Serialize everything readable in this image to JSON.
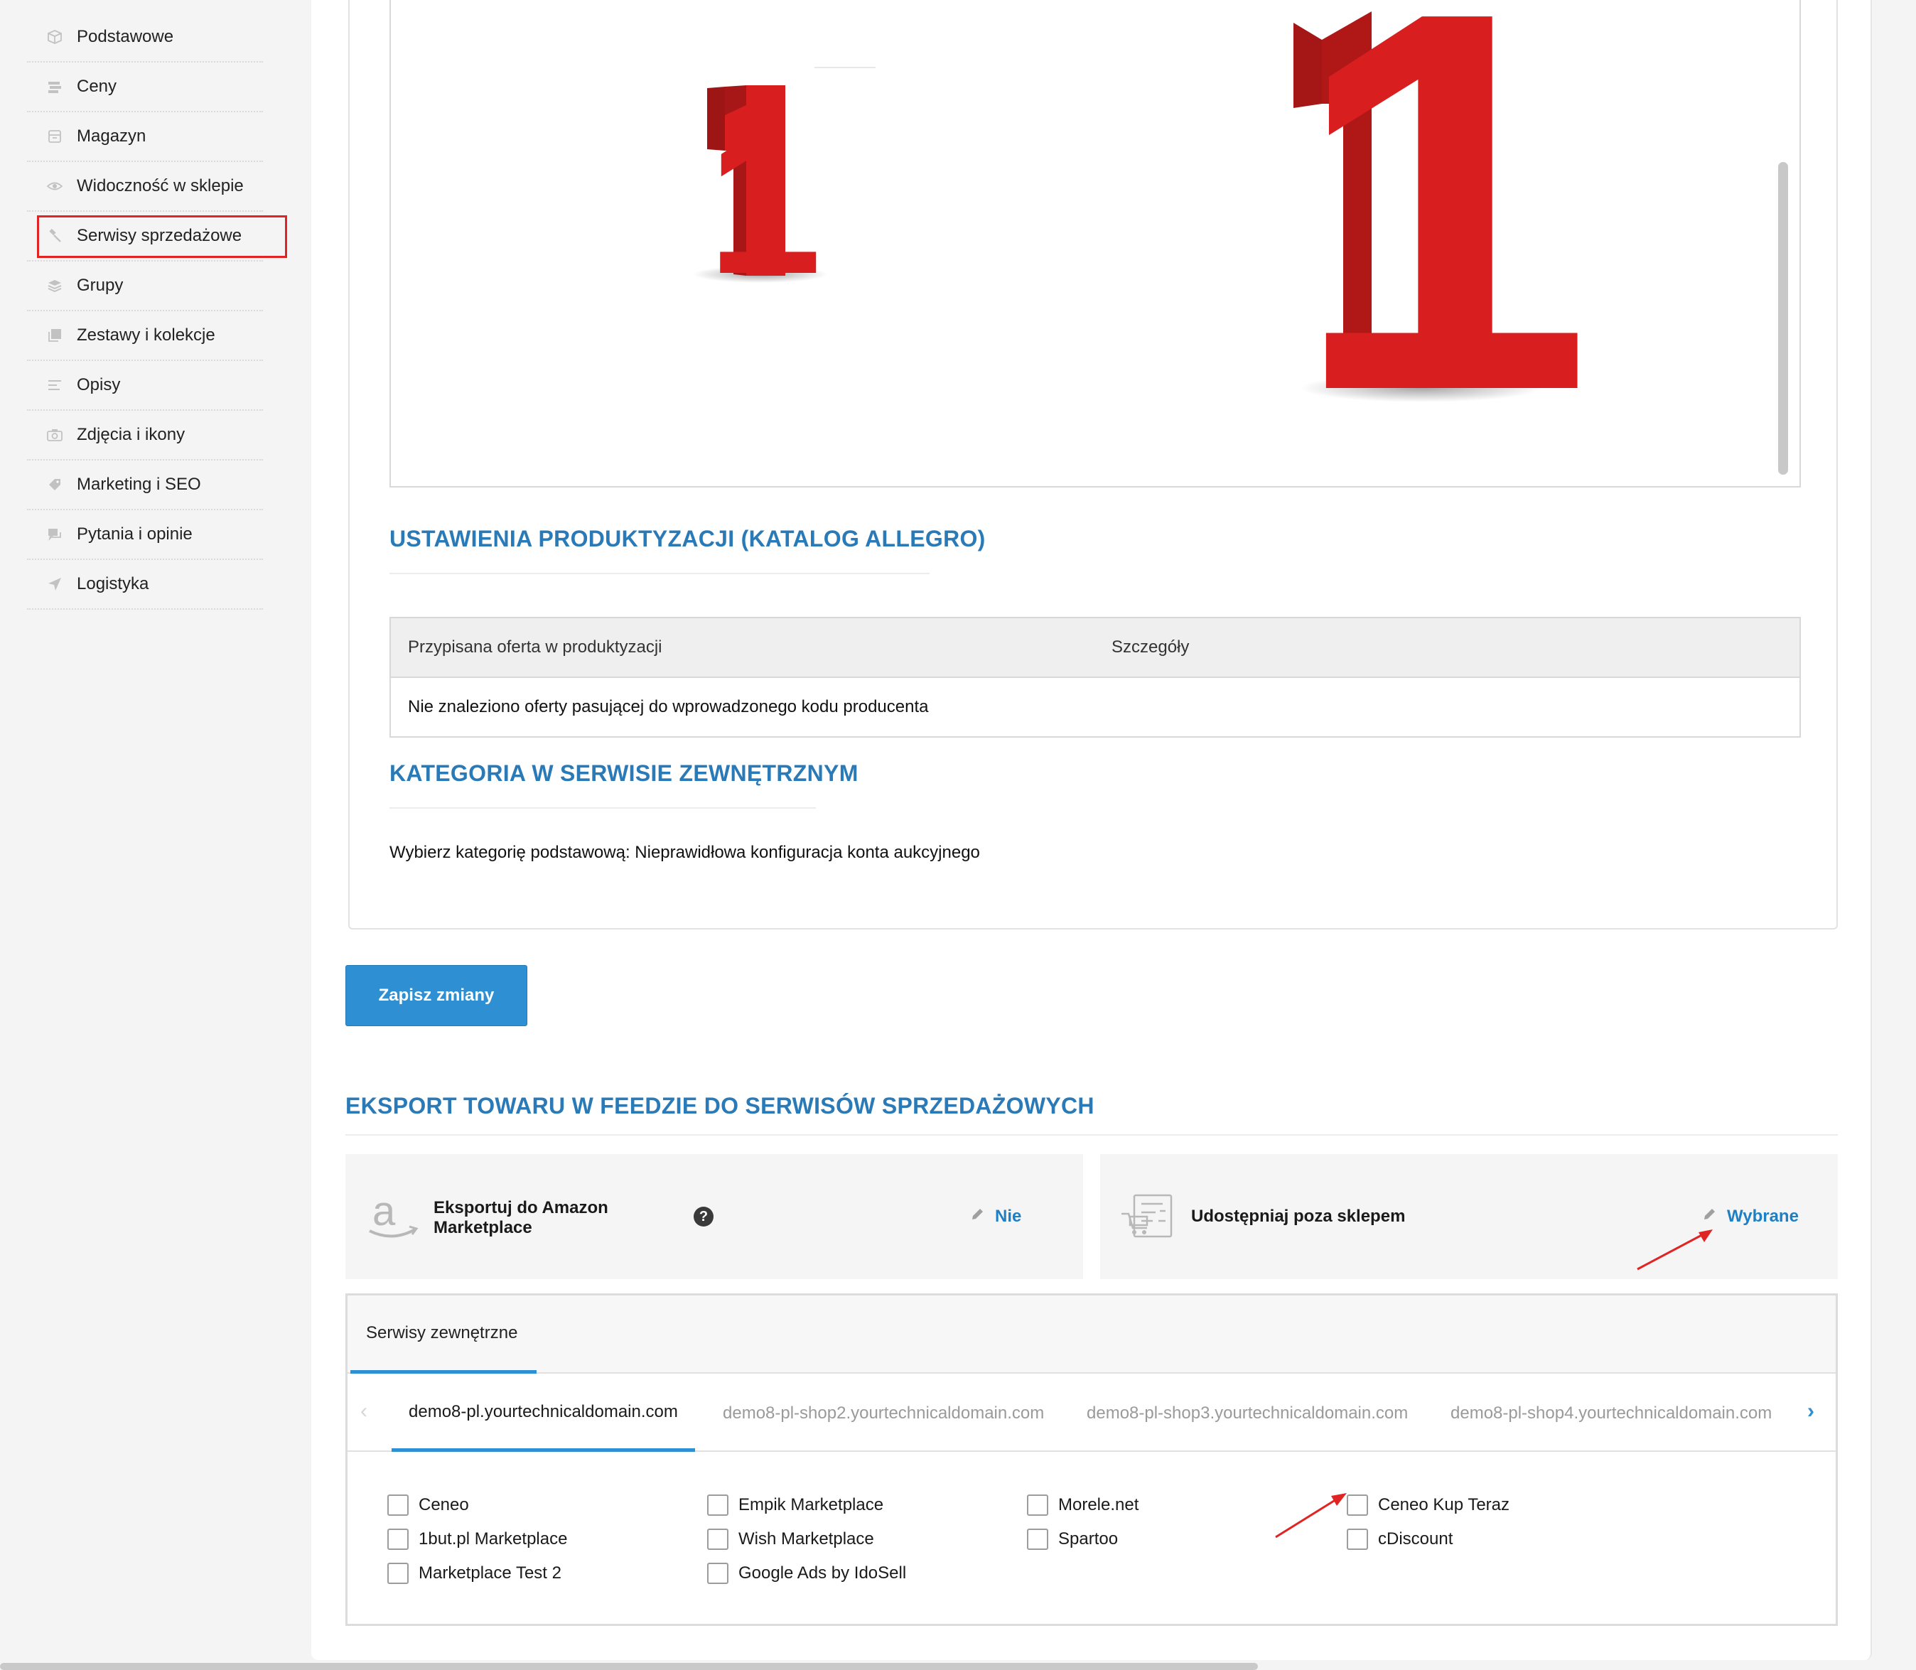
{
  "sidebar": {
    "items": [
      {
        "label": "Podstawowe",
        "icon": "box-icon"
      },
      {
        "label": "Ceny",
        "icon": "price-icon"
      },
      {
        "label": "Magazyn",
        "icon": "warehouse-icon"
      },
      {
        "label": "Widoczność w sklepie",
        "icon": "eye-icon"
      },
      {
        "label": "Serwisy sprzedażowe",
        "icon": "gavel-icon",
        "active": true
      },
      {
        "label": "Grupy",
        "icon": "layers-icon"
      },
      {
        "label": "Zestawy i kolekcje",
        "icon": "collection-icon"
      },
      {
        "label": "Opisy",
        "icon": "text-lines-icon"
      },
      {
        "label": "Zdjęcia i ikony",
        "icon": "camera-icon"
      },
      {
        "label": "Marketing i SEO",
        "icon": "tag-icon"
      },
      {
        "label": "Pytania i opinie",
        "icon": "chat-icon"
      },
      {
        "label": "Logistyka",
        "icon": "send-icon"
      }
    ]
  },
  "preview": {
    "small_digit": "1",
    "large_digit": "1"
  },
  "productization": {
    "title": "USTAWIENIA PRODUKTYZACJI (KATALOG ALLEGRO)",
    "col_offer": "Przypisana oferta w produktyzacji",
    "col_details": "Szczegóły",
    "empty_message": "Nie znaleziono oferty pasującej do wprowadzonego kodu producenta"
  },
  "category": {
    "title": "KATEGORIA W SERWISIE ZEWNĘTRZNYM",
    "text": "Wybierz kategorię podstawową: Nieprawidłowa konfiguracja konta aukcyjnego"
  },
  "save_button": "Zapisz zmiany",
  "export": {
    "title": "EKSPORT TOWARU W FEEDZIE DO SERWISÓW SPRZEDAŻOWYCH",
    "amazon_label": "Eksportuj do Amazon Marketplace",
    "amazon_value": "Nie",
    "share_label": "Udostępniaj poza sklepem",
    "share_value": "Wybrane",
    "help_glyph": "?"
  },
  "external": {
    "tab_label": "Serwisy zewnętrzne",
    "shops": [
      "demo8-pl.yourtechnicaldomain.com",
      "demo8-pl-shop2.yourtechnicaldomain.com",
      "demo8-pl-shop3.yourtechnicaldomain.com",
      "demo8-pl-shop4.yourtechnicaldomain.com"
    ],
    "services": [
      "Ceneo",
      "1but.pl Marketplace",
      "Marketplace Test 2",
      "Empik Marketplace",
      "Wish Marketplace",
      "Google Ads by IdoSell",
      "Morele.net",
      "Spartoo",
      "Ceneo Kup Teraz",
      "cDiscount"
    ]
  },
  "colors": {
    "accent": "#2f8fd3",
    "heading": "#2a7ab8",
    "highlight_red": "#e02424",
    "digit_red": "#d81e1e"
  }
}
